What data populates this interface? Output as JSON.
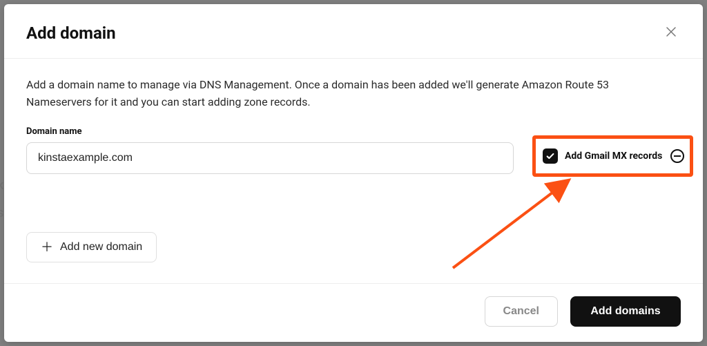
{
  "modal": {
    "title": "Add domain",
    "description": "Add a domain name to manage via DNS Management. Once a domain has been added we'll generate Amazon Route 53 Nameservers for it and you can start adding zone records.",
    "domain_field": {
      "label": "Domain name",
      "value": "kinstaexample.com"
    },
    "gmail_mx": {
      "label": "Add Gmail MX records",
      "checked": true
    },
    "add_new_label": "Add new domain"
  },
  "footer": {
    "cancel_label": "Cancel",
    "submit_label": "Add domains"
  },
  "annotation": {
    "highlight_color": "#fb5013"
  }
}
